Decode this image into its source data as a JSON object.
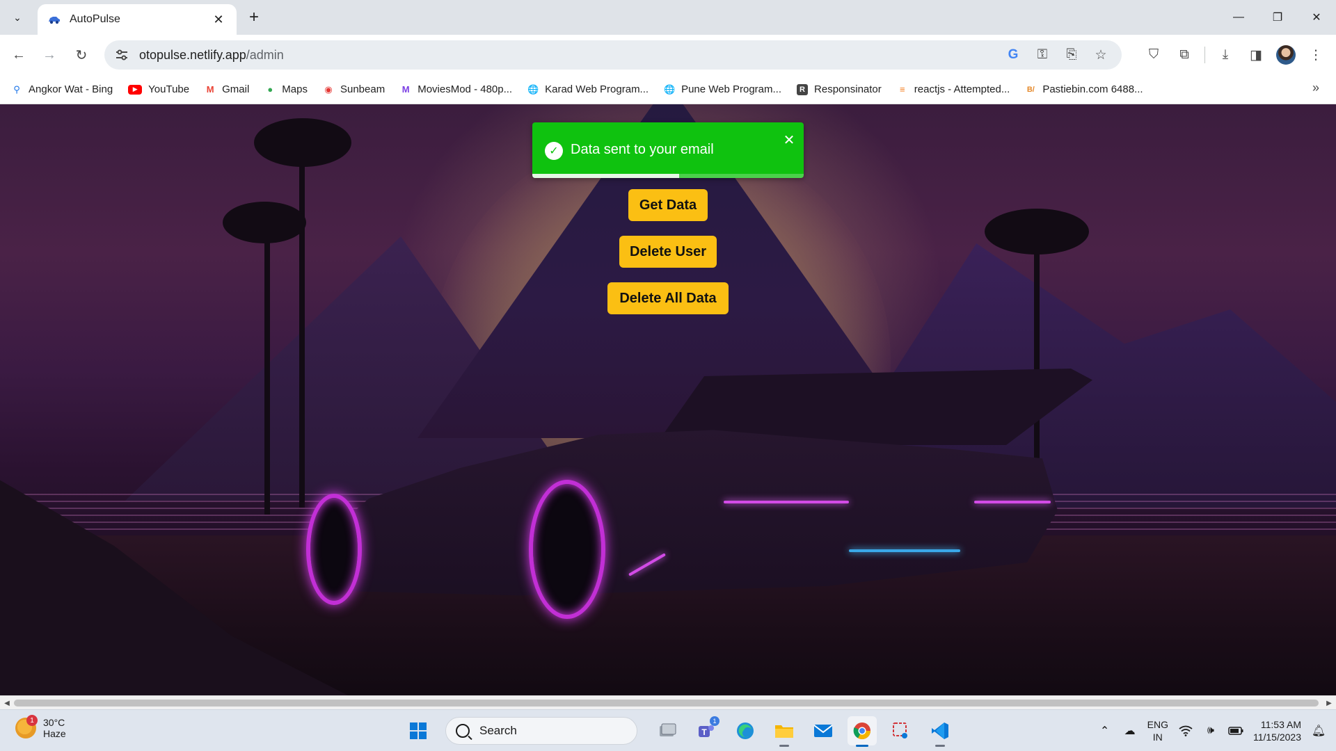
{
  "browser": {
    "tab_title": "AutoPulse",
    "url_host": "otopulse.netlify.app",
    "url_path": "/admin",
    "bookmarks": [
      {
        "label": "Angkor Wat - Bing",
        "icon": "bing-search-icon",
        "color": "#1a73e8"
      },
      {
        "label": "YouTube",
        "icon": "youtube-icon",
        "color": "#ff0000"
      },
      {
        "label": "Gmail",
        "icon": "gmail-icon",
        "color": "#ea4335"
      },
      {
        "label": "Maps",
        "icon": "maps-pin-icon",
        "color": "#34a853"
      },
      {
        "label": "Sunbeam",
        "icon": "sunbeam-icon",
        "color": "#e53935"
      },
      {
        "label": "MoviesMod - 480p...",
        "icon": "moviesmod-icon",
        "color": "#7b3fe4"
      },
      {
        "label": "Karad Web Program...",
        "icon": "globe-icon",
        "color": "#333333"
      },
      {
        "label": "Pune Web Program...",
        "icon": "globe-icon",
        "color": "#333333"
      },
      {
        "label": "Responsinator",
        "icon": "responsinator-icon",
        "color": "#444444"
      },
      {
        "label": "reactjs - Attempted...",
        "icon": "stackoverflow-icon",
        "color": "#f48024"
      },
      {
        "label": "Pastiebin.com 6488...",
        "icon": "pastiebin-icon",
        "color": "#e5892b"
      }
    ]
  },
  "page": {
    "toast": {
      "message": "Data sent to your email",
      "status": "success",
      "color": "#0fc20f",
      "progress_fraction": 0.54
    },
    "buttons": {
      "get_data": "Get Data",
      "delete_user": "Delete User",
      "delete_all": "Delete All Data"
    },
    "accent": "#fbbf13"
  },
  "taskbar": {
    "weather_temp": "30°C",
    "weather_condition": "Haze",
    "weather_badge": "1",
    "search_label": "Search",
    "teams_badge": "1",
    "lang_line1": "ENG",
    "lang_line2": "IN",
    "time": "11:53 AM",
    "date": "11/15/2023"
  }
}
